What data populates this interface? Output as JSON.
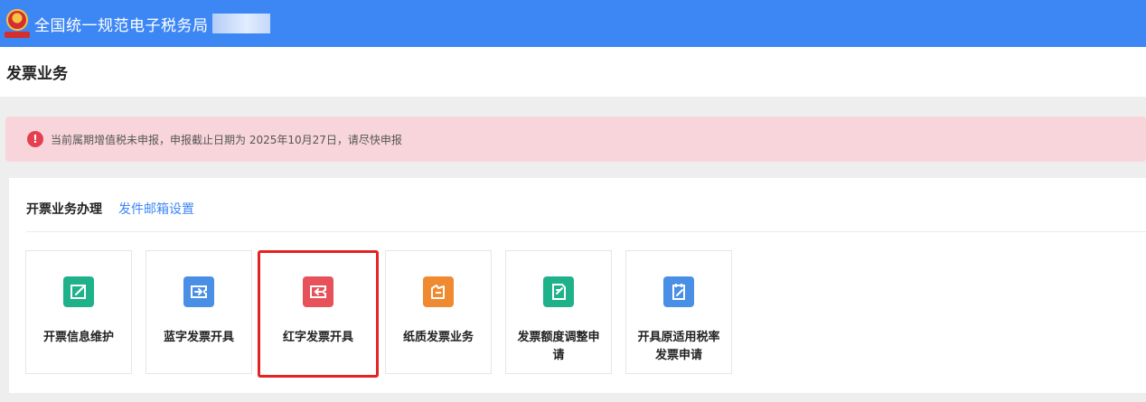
{
  "header": {
    "title": "全国统一规范电子税务局"
  },
  "page": {
    "title": "发票业务"
  },
  "alert": {
    "text": "当前属期增值税未申报，申报截止日期为 2025年10月27日，请尽快申报",
    "icon": "exclamation-icon",
    "icon_glyph": "!"
  },
  "panel": {
    "title": "开票业务办理",
    "link": "发件邮箱设置"
  },
  "cards": [
    {
      "label": "开票信息维护",
      "icon": "edit-box-icon",
      "color": "#1fb28a"
    },
    {
      "label": "蓝字发票开具",
      "icon": "blue-invoice-icon",
      "color": "#4a8fe6"
    },
    {
      "label": "红字发票开具",
      "icon": "red-invoice-icon",
      "color": "#e7525a",
      "selected": true
    },
    {
      "label": "纸质发票业务",
      "icon": "paper-invoice-icon",
      "color": "#f08a30"
    },
    {
      "label": "发票额度调整申请",
      "icon": "quota-adjust-icon",
      "color": "#1fb28a"
    },
    {
      "label": "开具原适用税率发票申请",
      "icon": "tax-rate-request-icon",
      "color": "#4a8fe6"
    }
  ],
  "colors": {
    "topbar": "#3d87f5",
    "alert_bg": "#f8d5da",
    "highlight": "#e52222"
  }
}
